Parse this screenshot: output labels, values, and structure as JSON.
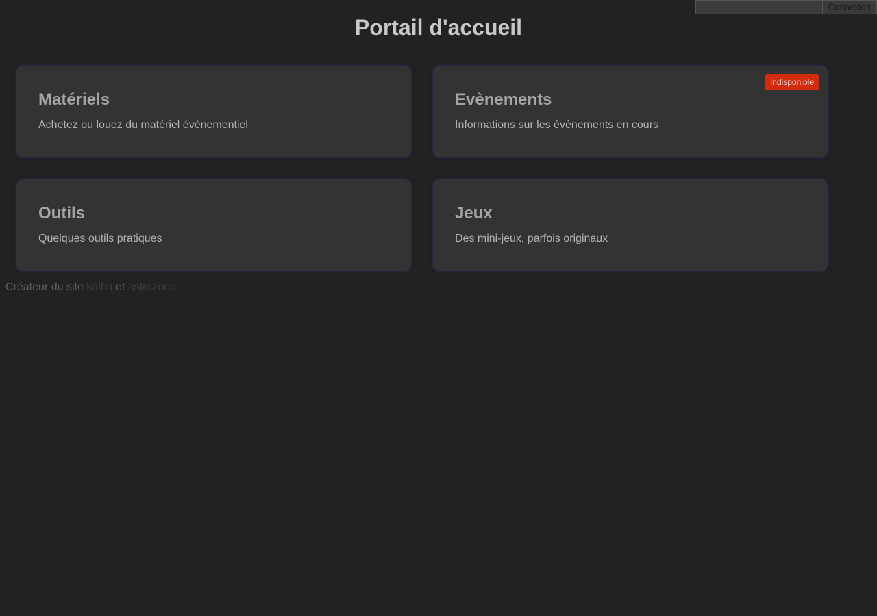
{
  "header": {
    "title": "Portail d'accueil",
    "login": {
      "input_value": "",
      "input_placeholder": "",
      "button_label": "Connexion"
    }
  },
  "cards": [
    {
      "title": "Matériels",
      "description": "Achetez ou louez du matériel évènementiel"
    },
    {
      "title": "Evènements",
      "description": "Informations sur les évènements en cours",
      "badge": "Indisponible"
    },
    {
      "title": "Outils",
      "description": "Quelques outils pratiques"
    },
    {
      "title": "Jeux",
      "description": "Des mini-jeux, parfois originaux"
    }
  ],
  "footer": {
    "prefix": "Créateur du site",
    "author1": "kalha",
    "separator": "et",
    "author2": "astrazone"
  },
  "colors": {
    "background": "#222222",
    "card_background": "#333333",
    "badge_background": "#d42a0e"
  }
}
